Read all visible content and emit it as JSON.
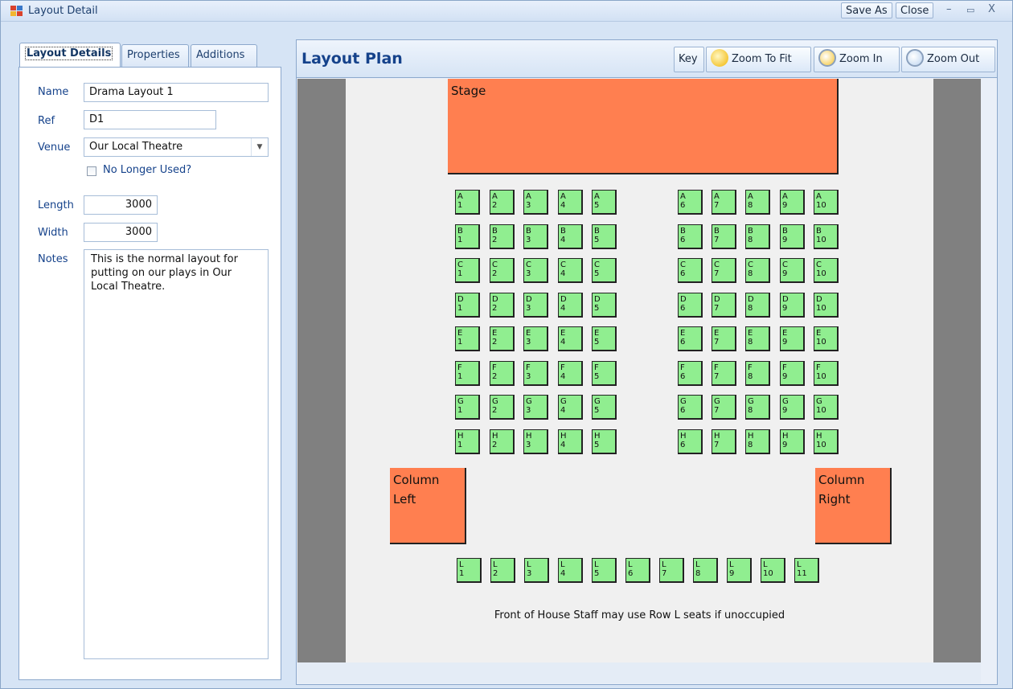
{
  "window": {
    "title": "Layout Detail",
    "save_as_label": "Save As",
    "close_label": "Close",
    "minimize_glyph": "–",
    "maximize_glyph": "▭",
    "close_glyph": "X"
  },
  "tabs": [
    {
      "label": "Layout Details"
    },
    {
      "label": "Properties"
    },
    {
      "label": "Additions"
    }
  ],
  "form": {
    "name_label": "Name",
    "name_value": "Drama Layout 1",
    "ref_label": "Ref",
    "ref_value": "D1",
    "venue_label": "Venue",
    "venue_value": "Our Local Theatre",
    "no_longer_used_label": "No Longer Used?",
    "no_longer_used_checked": false,
    "length_label": "Length",
    "length_value": "3000",
    "width_label": "Width",
    "width_value": "3000",
    "notes_label": "Notes",
    "notes_value": "This is the normal layout for putting on our plays in Our Local Theatre."
  },
  "plan": {
    "title": "Layout Plan",
    "key_label": "Key",
    "zoom_fit_label": "Zoom To Fit",
    "zoom_in_label": "Zoom In",
    "zoom_out_label": "Zoom Out",
    "stage_label": "Stage",
    "column_left_label": "Column\nLeft",
    "column_right_label": "Column\nRight",
    "note": "Front of House Staff may use Row L seats if unoccupied",
    "rows": [
      "A",
      "B",
      "C",
      "D",
      "E",
      "F",
      "G",
      "H"
    ],
    "left_numbers": [
      "1",
      "2",
      "3",
      "4",
      "5"
    ],
    "right_numbers": [
      "6",
      "7",
      "8",
      "9",
      "10"
    ],
    "row_l": {
      "row": "L",
      "numbers": [
        "1",
        "2",
        "3",
        "4",
        "5",
        "6",
        "7",
        "8",
        "9",
        "10",
        "11"
      ]
    },
    "colors": {
      "stage": "#ff7f50",
      "seat": "#90ee90",
      "background": "#f0f0f0",
      "margin": "#808080"
    }
  }
}
